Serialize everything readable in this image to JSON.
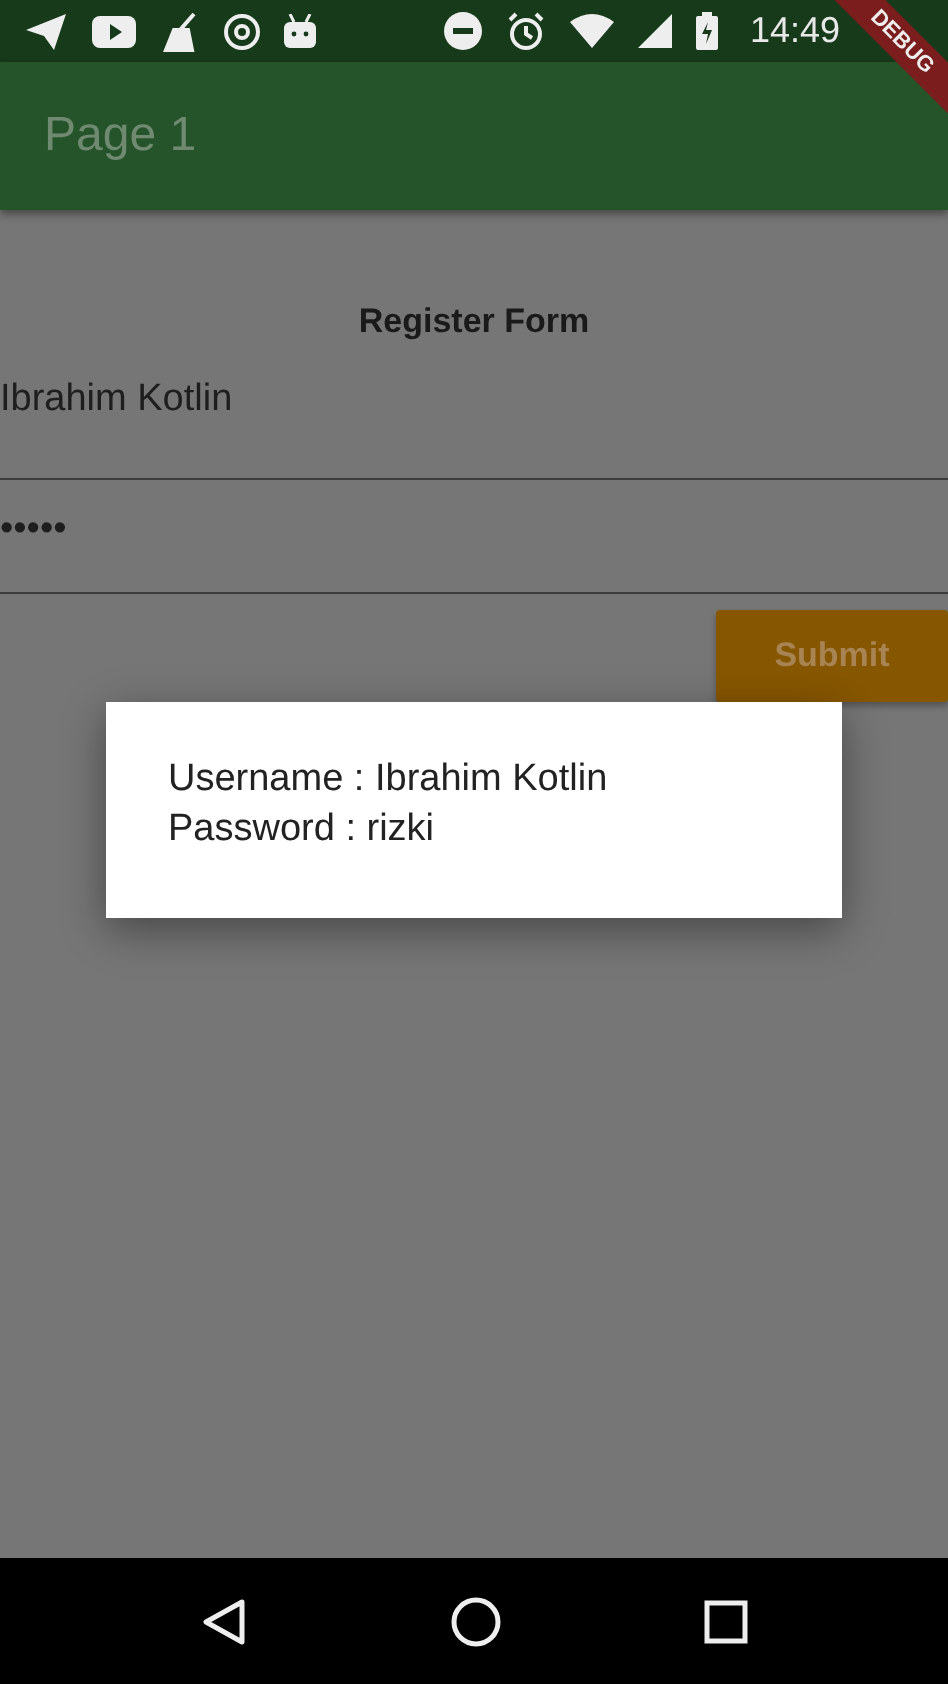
{
  "status_bar": {
    "time": "14:49"
  },
  "app_bar": {
    "title": "Page 1"
  },
  "debug_banner": {
    "label": "DEBUG"
  },
  "form": {
    "heading": "Register Form",
    "username": {
      "value": "Ibrahim Kotlin"
    },
    "password": {
      "value": "•••••"
    },
    "submit": {
      "label": "Submit"
    }
  },
  "dialog": {
    "lines": [
      "Username : Ibrahim Kotlin",
      "Password : rizki"
    ]
  }
}
